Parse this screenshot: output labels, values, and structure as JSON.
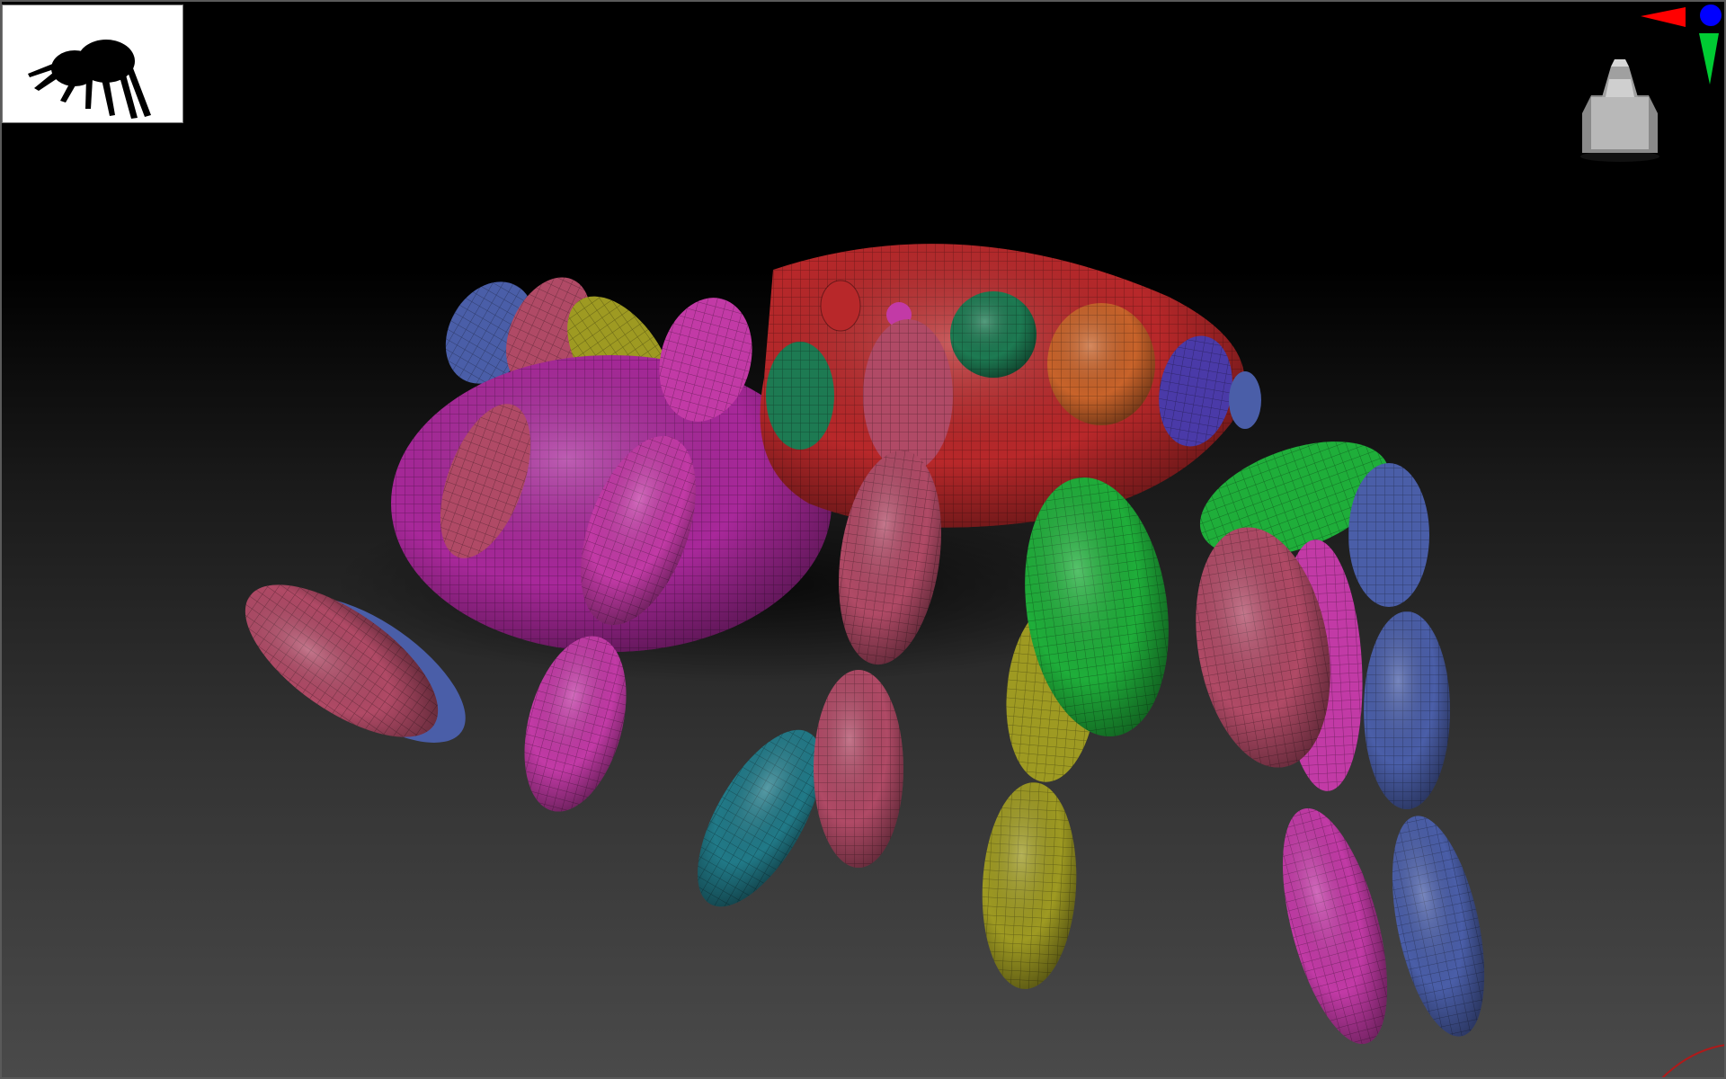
{
  "window": {
    "title": ""
  },
  "viewport": {
    "background_top": "#000000",
    "background_bottom": "#4a4a4a",
    "frame_color": "#5a5a5a"
  },
  "thumbnail": {
    "icon": "spider-silhouette-icon",
    "background": "#ffffff",
    "fill": "#000000"
  },
  "model": {
    "name": "",
    "colors": {
      "cephalothorax": "#b8282a",
      "abdomen": "#a8289a",
      "magenta": "#c23aa6",
      "rose": "#b04a66",
      "green": "#1fae3a",
      "dark_green": "#1d7a52",
      "teal": "#217a88",
      "olive": "#9e9a22",
      "blue": "#4a5ea8",
      "orange": "#c8632a",
      "violet": "#4a3aa8"
    }
  },
  "gizmo": {
    "x_axis_color": "#ff0000",
    "y_axis_color": "#00cc33",
    "z_axis_color": "#0000ff",
    "icon": "axis-gizmo-icon"
  },
  "navcube": {
    "icon": "view-cube-icon",
    "color": "#b0b0b0"
  }
}
